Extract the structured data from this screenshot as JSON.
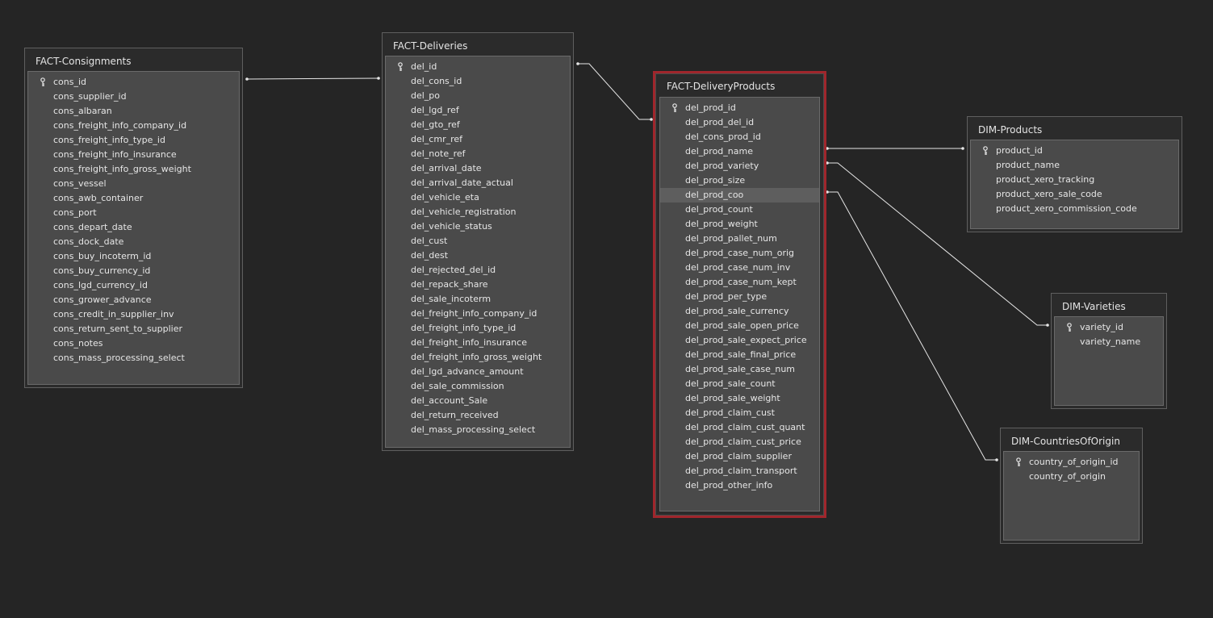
{
  "tables": {
    "consignments": {
      "title": "FACT-Consignments",
      "fields": [
        "cons_id",
        "cons_supplier_id",
        "cons_albaran",
        "cons_freight_info_company_id",
        "cons_freight_info_type_id",
        "cons_freight_info_insurance",
        "cons_freight_info_gross_weight",
        "cons_vessel",
        "cons_awb_container",
        "cons_port",
        "cons_depart_date",
        "cons_dock_date",
        "cons_buy_incoterm_id",
        "cons_buy_currency_id",
        "cons_lgd_currency_id",
        "cons_grower_advance",
        "cons_credit_in_supplier_inv",
        "cons_return_sent_to_supplier",
        "cons_notes",
        "cons_mass_processing_select"
      ],
      "key_field": "cons_id"
    },
    "deliveries": {
      "title": "FACT-Deliveries",
      "fields": [
        "del_id",
        "del_cons_id",
        "del_po",
        "del_lgd_ref",
        "del_gto_ref",
        "del_cmr_ref",
        "del_note_ref",
        "del_arrival_date",
        "del_arrival_date_actual",
        "del_vehicle_eta",
        "del_vehicle_registration",
        "del_vehicle_status",
        "del_cust",
        "del_dest",
        "del_rejected_del_id",
        "del_repack_share",
        "del_sale_incoterm",
        "del_freight_info_company_id",
        "del_freight_info_type_id",
        "del_freight_info_insurance",
        "del_freight_info_gross_weight",
        "del_lgd_advance_amount",
        "del_sale_commission",
        "del_account_Sale",
        "del_return_received",
        "del_mass_processing_select"
      ],
      "key_field": "del_id"
    },
    "delivery_products": {
      "title": "FACT-DeliveryProducts",
      "fields": [
        "del_prod_id",
        "del_prod_del_id",
        "del_cons_prod_id",
        "del_prod_name",
        "del_prod_variety",
        "del_prod_size",
        "del_prod_coo",
        "del_prod_count",
        "del_prod_weight",
        "del_prod_pallet_num",
        "del_prod_case_num_orig",
        "del_prod_case_num_inv",
        "del_prod_case_num_kept",
        "del_prod_per_type",
        "del_prod_sale_currency",
        "del_prod_sale_open_price",
        "del_prod_sale_expect_price",
        "del_prod_sale_final_price",
        "del_prod_sale_case_num",
        "del_prod_sale_count",
        "del_prod_sale_weight",
        "del_prod_claim_cust",
        "del_prod_claim_cust_quant",
        "del_prod_claim_cust_price",
        "del_prod_claim_supplier",
        "del_prod_claim_transport",
        "del_prod_other_info"
      ],
      "key_field": "del_prod_id",
      "highlighted_field": "del_prod_coo",
      "selected": true
    },
    "products": {
      "title": "DIM-Products",
      "fields": [
        "product_id",
        "product_name",
        "product_xero_tracking",
        "product_xero_sale_code",
        "product_xero_commission_code"
      ],
      "key_field": "product_id"
    },
    "varieties": {
      "title": "DIM-Varieties",
      "fields": [
        "variety_id",
        "variety_name"
      ],
      "key_field": "variety_id"
    },
    "countries": {
      "title": "DIM-CountriesOfOrigin",
      "fields": [
        "country_of_origin_id",
        "country_of_origin"
      ],
      "key_field": "country_of_origin_id"
    }
  },
  "relationships": [
    {
      "from": "consignments.cons_id",
      "to": "deliveries.del_cons_id"
    },
    {
      "from": "deliveries.del_id",
      "to": "delivery_products.del_prod_del_id"
    },
    {
      "from": "delivery_products.del_prod_name",
      "to": "products.product_id"
    },
    {
      "from": "delivery_products.del_prod_variety",
      "to": "varieties.variety_id"
    },
    {
      "from": "delivery_products.del_prod_coo",
      "to": "countries.country_of_origin_id"
    }
  ],
  "colors": {
    "background": "#252525",
    "selection_border": "#a0262c",
    "connector": "#e6e6e6",
    "table_body": "#4a4a4a",
    "text": "#e6e6e6"
  },
  "icons": {
    "key_field": "key-icon"
  }
}
